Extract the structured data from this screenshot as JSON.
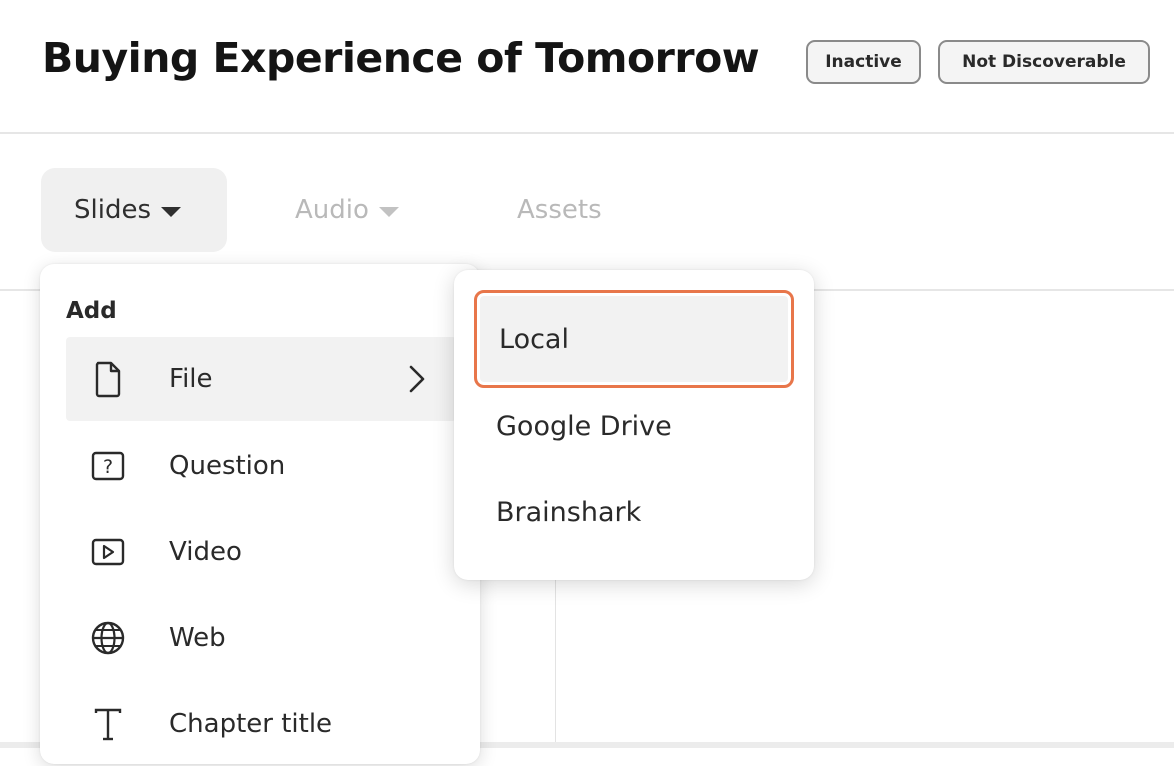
{
  "header": {
    "title": "Buying Experience of Tomorrow",
    "badges": [
      "Inactive",
      "Not Discoverable"
    ]
  },
  "tabs": [
    {
      "label": "Slides",
      "active": true,
      "has_caret": true
    },
    {
      "label": "Audio",
      "active": false,
      "has_caret": true
    },
    {
      "label": "Assets",
      "active": false,
      "has_caret": false
    }
  ],
  "add_menu": {
    "heading": "Add",
    "items": [
      {
        "label": "File",
        "icon": "file-icon",
        "has_submenu": true,
        "hovered": true
      },
      {
        "label": "Question",
        "icon": "question-icon"
      },
      {
        "label": "Video",
        "icon": "video-icon"
      },
      {
        "label": "Web",
        "icon": "globe-icon"
      },
      {
        "label": "Chapter title",
        "icon": "text-t-icon"
      }
    ]
  },
  "file_submenu": {
    "items": [
      {
        "label": "Local",
        "highlighted": true
      },
      {
        "label": "Google Drive"
      },
      {
        "label": "Brainshark"
      }
    ]
  },
  "colors": {
    "highlight_border": "#e8764a",
    "active_tab_bg": "#f0f0f0",
    "inactive_text": "#b9b9b9"
  }
}
